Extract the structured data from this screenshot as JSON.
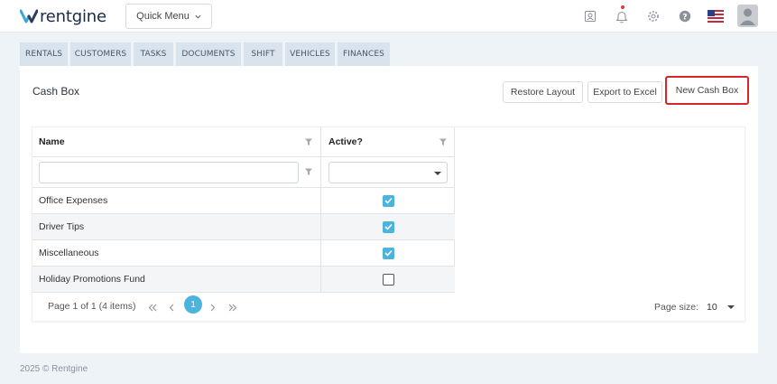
{
  "app": {
    "name": "rentgine",
    "accent_color": "#4cb3dd",
    "highlight_color": "#d7262b"
  },
  "topbar": {
    "quick_menu_label": "Quick Menu",
    "icons": [
      "contact-card-icon",
      "bell-icon",
      "gear-icon",
      "help-icon",
      "us-flag-icon",
      "user-avatar-icon"
    ]
  },
  "tabs": [
    {
      "label": "RENTALS"
    },
    {
      "label": "CUSTOMERS"
    },
    {
      "label": "TASKS"
    },
    {
      "label": "DOCUMENTS"
    },
    {
      "label": "SHIFT"
    },
    {
      "label": "VEHICLES"
    },
    {
      "label": "FINANCES"
    }
  ],
  "page": {
    "title": "Cash Box",
    "buttons": {
      "restore_layout": "Restore Layout",
      "export_excel": "Export to Excel",
      "new_cash_box": "New Cash Box"
    }
  },
  "grid": {
    "columns": {
      "name": "Name",
      "active": "Active?"
    },
    "filters": {
      "name_value": "",
      "active_value": ""
    },
    "rows": [
      {
        "name": "Office Expenses",
        "active": true
      },
      {
        "name": "Driver Tips",
        "active": true
      },
      {
        "name": "Miscellaneous",
        "active": true
      },
      {
        "name": "Holiday Promotions Fund",
        "active": false
      }
    ]
  },
  "pager": {
    "summary": "Page 1 of 1 (4 items)",
    "current_page": "1",
    "page_size_label": "Page size:",
    "page_size_value": "10"
  },
  "footer": {
    "copyright": "2025 © Rentgine"
  }
}
